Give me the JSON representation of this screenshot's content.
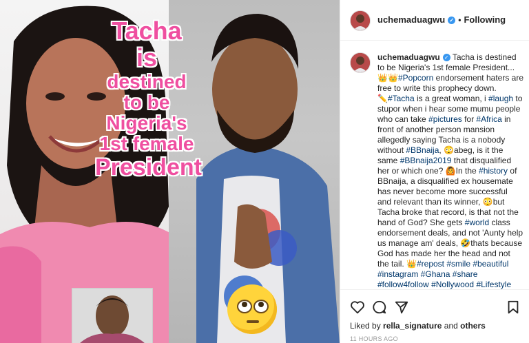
{
  "post": {
    "overlay_lines": [
      "Tacha",
      "is",
      "destined",
      "to be",
      "Nigeria's",
      "1st female",
      "President"
    ],
    "emoji": "🙄"
  },
  "header": {
    "username": "uchemaduagwu",
    "separator": "•",
    "follow_state": "Following"
  },
  "caption": {
    "username": "uchemaduagwu",
    "parts": [
      {
        "t": "Tacha is destined to be Nigeria's 1st female President... 👑👑"
      },
      {
        "t": "#Popcorn",
        "tag": true
      },
      {
        "t": " endorsement haters are free to write this prophecy down. ✏️"
      },
      {
        "t": "#Tacha",
        "tag": true
      },
      {
        "t": " is a great woman, i "
      },
      {
        "t": "#laugh",
        "tag": true
      },
      {
        "t": " to stupor when i hear some mumu people who can take "
      },
      {
        "t": "#pictures",
        "tag": true
      },
      {
        "t": " for "
      },
      {
        "t": "#Africa",
        "tag": true
      },
      {
        "t": " in front of another person mansion allegedly saying Tacha is a nobody without "
      },
      {
        "t": "#BBnaija",
        "tag": true
      },
      {
        "t": ", 😳abeg, is it the same "
      },
      {
        "t": "#BBnaija2019",
        "tag": true
      },
      {
        "t": " that disqualified her or which one? 🙆In the "
      },
      {
        "t": "#history",
        "tag": true
      },
      {
        "t": " of BBnaija, a disqualified ex housemate has never become more successful and relevant than its winner, 😳but Tacha broke that record, is that not the hand of God? She gets "
      },
      {
        "t": "#world",
        "tag": true
      },
      {
        "t": " class endorsement deals, and not 'Aunty help us manage am' deals, 🤣thats because God has made her the head and not the tail. 👑"
      },
      {
        "t": "#repost",
        "tag": true
      },
      {
        "t": " "
      },
      {
        "t": "#smile",
        "tag": true
      },
      {
        "t": " "
      },
      {
        "t": "#beautiful",
        "tag": true
      },
      {
        "t": " "
      },
      {
        "t": "#instagram",
        "tag": true
      },
      {
        "t": " "
      },
      {
        "t": "#Ghana",
        "tag": true
      },
      {
        "t": " "
      },
      {
        "t": "#share",
        "tag": true
      },
      {
        "t": " "
      },
      {
        "t": "#follow4follow",
        "tag": true
      },
      {
        "t": " "
      },
      {
        "t": "#Nollywood",
        "tag": true
      },
      {
        "t": " "
      },
      {
        "t": "#Lifestyle",
        "tag": true
      }
    ]
  },
  "actions": {
    "icons": [
      "heart-icon",
      "comment-icon",
      "share-icon",
      "bookmark-icon"
    ]
  },
  "likes": {
    "prefix": "Liked by",
    "user": "rella_signature",
    "joiner": "and",
    "others": "others"
  },
  "timestamp": "11 HOURS AGO",
  "colors": {
    "overlay": "#ef4fa0",
    "link": "#00376b",
    "verified": "#3897f0"
  }
}
